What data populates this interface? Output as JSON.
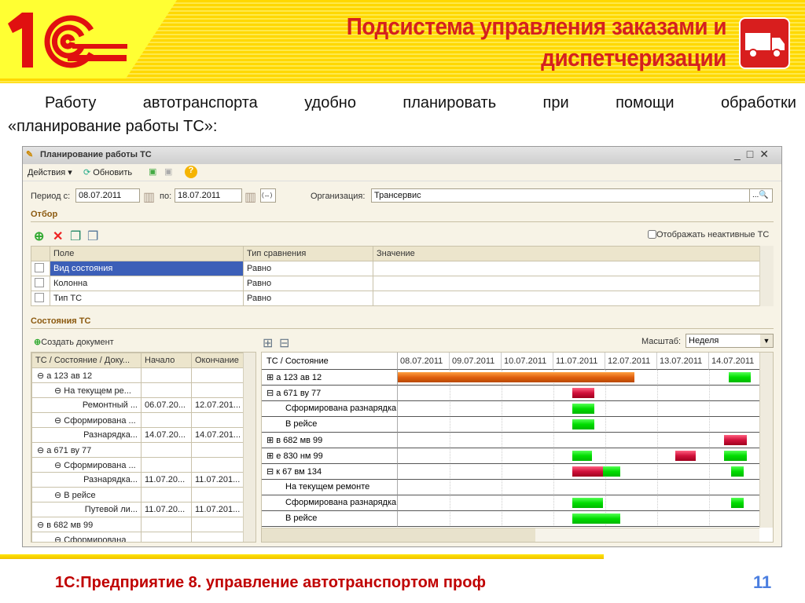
{
  "slide": {
    "title_line1": "Подсистема управления заказами и",
    "title_line2": "диспетчеризации",
    "logo_text": "1С",
    "intro_line1_words": [
      "Работу",
      "автотранспорта",
      "удобно",
      "планировать",
      "при",
      "помощи",
      "обработки"
    ],
    "intro_line2": "«планирование работы ТС»:",
    "footer": "1С:Предприятие 8. управление автотранспортом проф",
    "page_number": "11"
  },
  "window": {
    "title": "Планирование работы ТС",
    "toolbar": {
      "actions": "Действия ▾",
      "refresh": "Обновить"
    },
    "period_from_label": "Период с:",
    "period_from": "08.07.2011",
    "period_to_label": "по:",
    "period_to": "18.07.2011",
    "period_btn": "(↔)",
    "org_label": "Организация:",
    "org_value": "Трансервис",
    "filter_section": "Отбор",
    "show_inactive": "Отображать неактивные ТС",
    "filter_headers": [
      "Поле",
      "Тип сравнения",
      "Значение"
    ],
    "filter_rows": [
      {
        "field": "Вид состояния",
        "cmp": "Равно",
        "value": ""
      },
      {
        "field": "Колонна",
        "cmp": "Равно",
        "value": ""
      },
      {
        "field": "Тип ТС",
        "cmp": "Равно",
        "value": ""
      }
    ],
    "states_section": "Состояния ТС",
    "create_doc": "Создать документ",
    "tree_headers": [
      "ТС / Состояние / Доку...",
      "Начало",
      "Окончание"
    ],
    "tree_rows": [
      {
        "name": "⊖ а 123 ав 12",
        "start": "",
        "end": "",
        "level": 0
      },
      {
        "name": "⊖ На текущем ре...",
        "start": "",
        "end": "",
        "level": 1
      },
      {
        "name": "Ремонтный ...",
        "start": "06.07.20...",
        "end": "12.07.201...",
        "level": 2
      },
      {
        "name": "⊖ Сформирована ...",
        "start": "",
        "end": "",
        "level": 1
      },
      {
        "name": "Разнарядка...",
        "start": "14.07.20...",
        "end": "14.07.201...",
        "level": 2
      },
      {
        "name": "⊖ а 671 ву 77",
        "start": "",
        "end": "",
        "level": 0
      },
      {
        "name": "⊖ Сформирована ...",
        "start": "",
        "end": "",
        "level": 1
      },
      {
        "name": "Разнарядка...",
        "start": "11.07.20...",
        "end": "11.07.201...",
        "level": 2
      },
      {
        "name": "⊖ В рейсе",
        "start": "",
        "end": "",
        "level": 1
      },
      {
        "name": "Путевой ли...",
        "start": "11.07.20...",
        "end": "11.07.201...",
        "level": 2
      },
      {
        "name": "⊖ в 682 мв 99",
        "start": "",
        "end": "",
        "level": 0
      },
      {
        "name": "⊖ Сформирована",
        "start": "",
        "end": "",
        "level": 1
      }
    ],
    "scale_label": "Масштаб:",
    "scale_value": "Неделя",
    "gantt_header": "ТС / Состояние",
    "gantt_dates": [
      "08.07.2011",
      "09.07.2011",
      "10.07.2011",
      "11.07.2011",
      "12.07.2011",
      "13.07.2011",
      "14.07.2011"
    ],
    "gantt_rows": [
      {
        "label": "⊞ а 123 ав 12",
        "indent": false,
        "bars": [
          {
            "s": 0,
            "e": 4.56,
            "c": "orange"
          },
          {
            "s": 6.38,
            "e": 6.8,
            "c": "green"
          }
        ]
      },
      {
        "label": "⊟ а 671 ву 77",
        "indent": false,
        "bars": [
          {
            "s": 3.36,
            "e": 3.79,
            "c": "red"
          }
        ]
      },
      {
        "label": "Сформирована разнарядка",
        "indent": true,
        "bars": [
          {
            "s": 3.36,
            "e": 3.79,
            "c": "green"
          }
        ]
      },
      {
        "label": "В рейсе",
        "indent": true,
        "bars": [
          {
            "s": 3.36,
            "e": 3.79,
            "c": "green"
          }
        ]
      },
      {
        "label": "⊞ в 682 мв 99",
        "indent": false,
        "bars": [
          {
            "s": 6.29,
            "e": 6.72,
            "c": "red"
          }
        ]
      },
      {
        "label": "⊞ е 830 нм 99",
        "indent": false,
        "bars": [
          {
            "s": 3.36,
            "e": 3.74,
            "c": "green"
          },
          {
            "s": 5.35,
            "e": 5.74,
            "c": "red"
          },
          {
            "s": 6.29,
            "e": 6.72,
            "c": "green"
          }
        ]
      },
      {
        "label": "⊟ к 67 вм 134",
        "indent": false,
        "bars": [
          {
            "s": 3.36,
            "e": 3.95,
            "c": "red"
          },
          {
            "s": 3.95,
            "e": 4.29,
            "c": "green"
          },
          {
            "s": 6.42,
            "e": 6.67,
            "c": "green"
          }
        ]
      },
      {
        "label": "На текущем ремонте",
        "indent": true,
        "bars": []
      },
      {
        "label": "Сформирована разнарядка",
        "indent": true,
        "bars": [
          {
            "s": 3.36,
            "e": 3.95,
            "c": "green"
          },
          {
            "s": 6.42,
            "e": 6.67,
            "c": "green"
          }
        ]
      },
      {
        "label": "В рейсе",
        "indent": true,
        "bars": [
          {
            "s": 3.36,
            "e": 4.29,
            "c": "green"
          }
        ]
      }
    ]
  }
}
